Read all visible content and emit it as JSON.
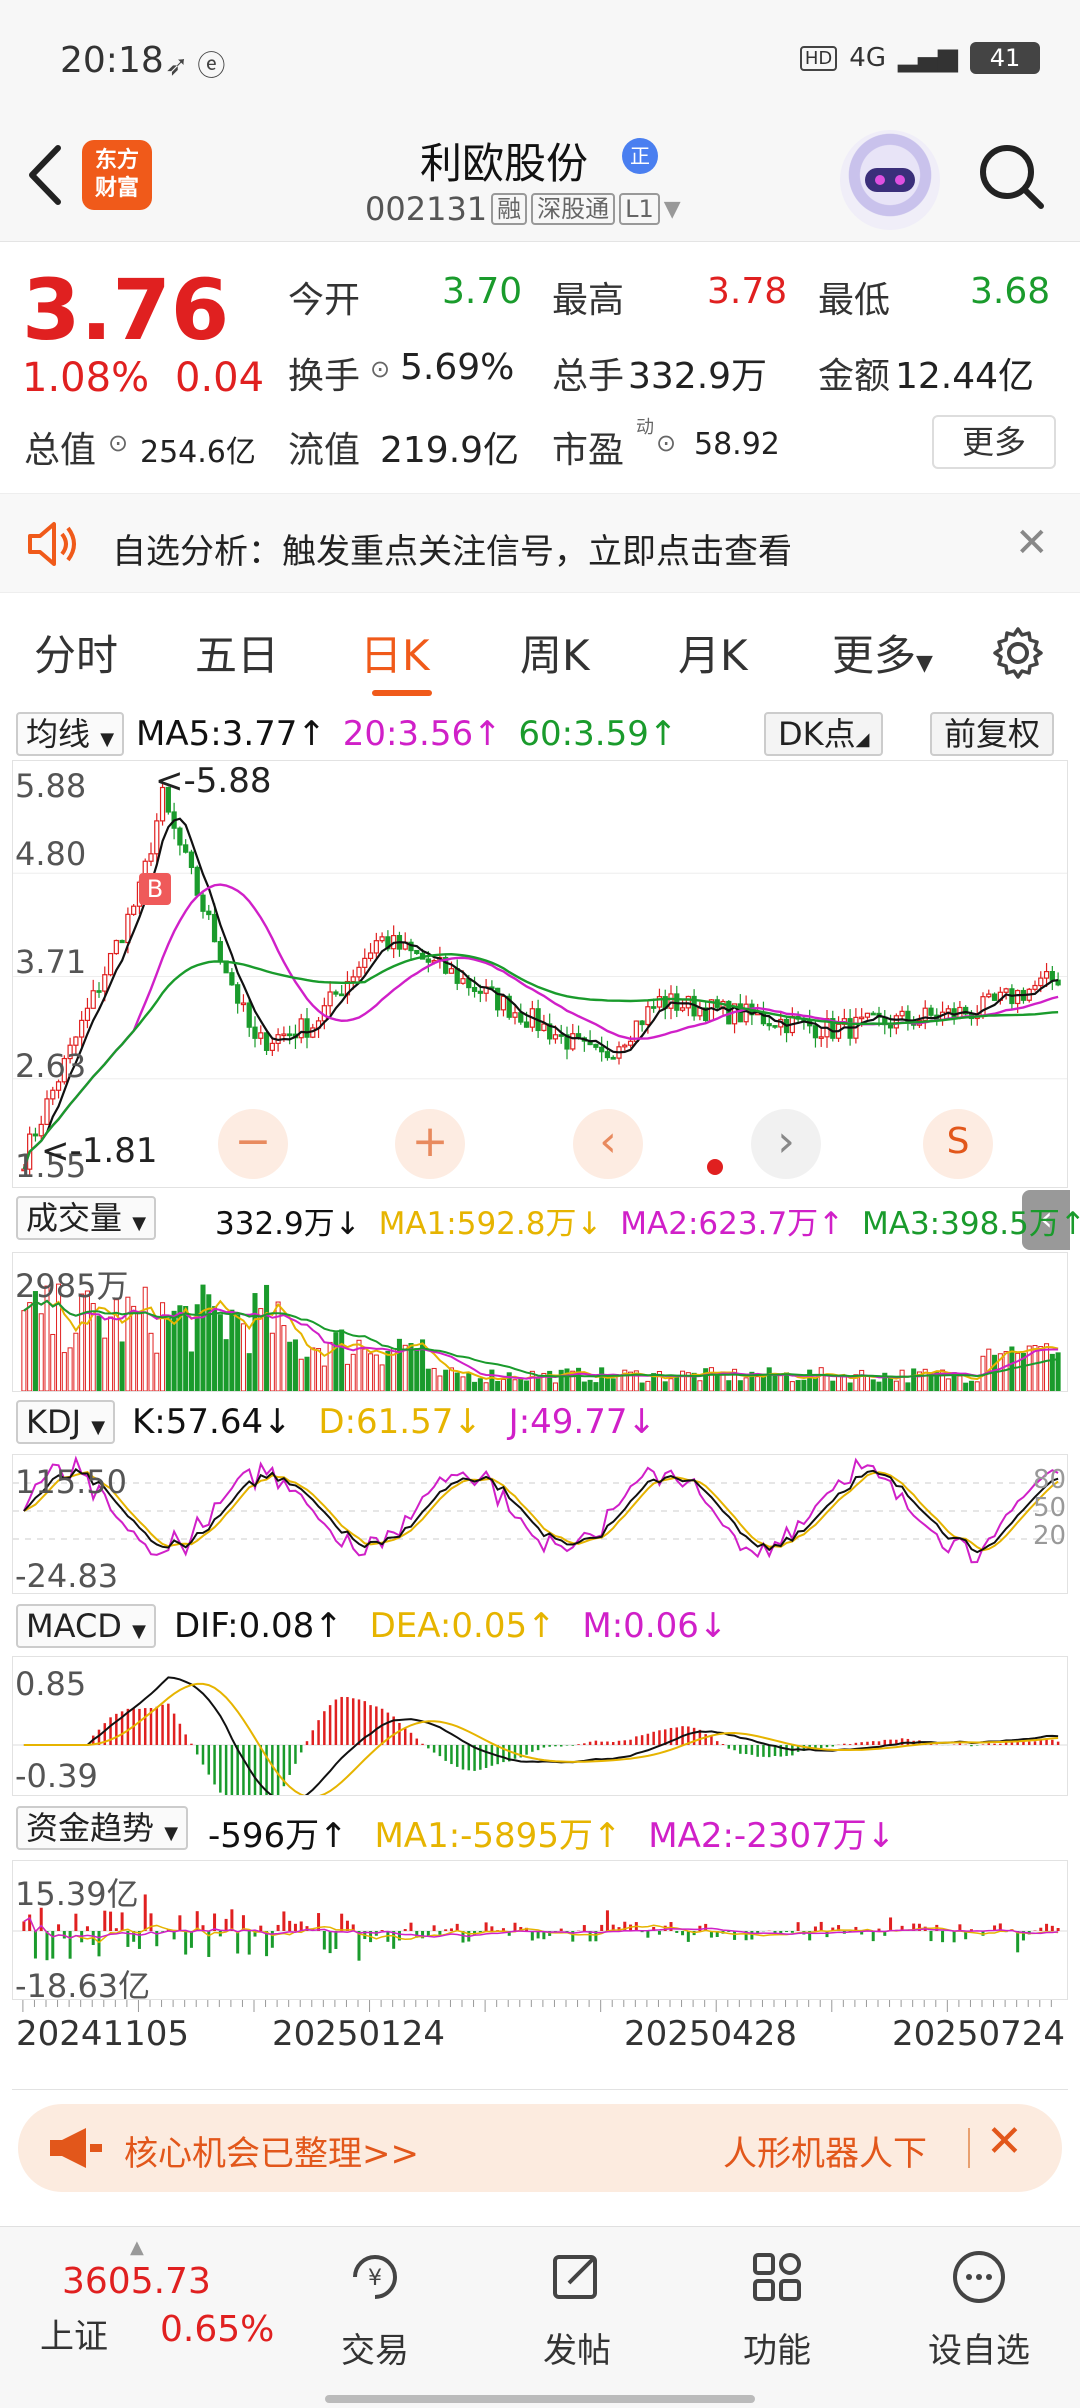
{
  "status": {
    "time": "20:18",
    "network": "4G",
    "battery": "41"
  },
  "header": {
    "logo_line1": "东方",
    "logo_line2": "财富",
    "stock_name": "利欧股份",
    "badge": "正",
    "stock_code": "002131",
    "tags": [
      "融",
      "深股通",
      "L1"
    ]
  },
  "quote": {
    "price": "3.76",
    "change_pct": "1.08%",
    "change": "0.04",
    "open_label": "今开",
    "open": "3.70",
    "high_label": "最高",
    "high": "3.78",
    "low_label": "最低",
    "low": "3.68",
    "turnover_label": "换手",
    "turnover": "5.69%",
    "volume_label": "总手",
    "volume": "332.9万",
    "amount_label": "金额",
    "amount": "12.44亿",
    "mcap_label": "总值",
    "mcap": "254.6亿",
    "float_label": "流值",
    "float_cap": "219.9亿",
    "pe_label": "市盈",
    "pe_sup": "动",
    "pe": "58.92",
    "more_label": "更多"
  },
  "alert": {
    "text": "自选分析：触发重点关注信号，立即点击查看"
  },
  "tabs": [
    "分时",
    "五日",
    "日K",
    "周K",
    "月K",
    "更多"
  ],
  "active_tab": "日K",
  "main_chart": {
    "indicator": "均线",
    "ma5": "MA5:3.77↑",
    "ma20": "20:3.56↑",
    "ma60": "60:3.59↑",
    "dk_label": "DK点",
    "adjust_label": "前复权",
    "y_labels": [
      "5.88",
      "4.80",
      "3.71",
      "2.63",
      "1.55"
    ],
    "high_marker": "<-5.88",
    "low_marker": "<-1.81",
    "buy_marker": "B"
  },
  "volume_panel": {
    "indicator": "成交量",
    "value": "332.9万↓",
    "ma1": "MA1:592.8万↓",
    "ma2": "MA2:623.7万↑",
    "ma3": "MA3:398.5万↑",
    "y_label": "2985万"
  },
  "kdj_panel": {
    "indicator": "KDJ",
    "k": "K:57.64↓",
    "d": "D:61.57↓",
    "j": "J:49.77↓",
    "y_top": "115.50",
    "y_bottom": "-24.83",
    "ref_80": "80",
    "ref_50": "50",
    "ref_20": "20"
  },
  "macd_panel": {
    "indicator": "MACD",
    "dif": "DIF:0.08↑",
    "dea": "DEA:0.05↑",
    "m": "M:0.06↓",
    "y_top": "0.85",
    "y_bottom": "-0.39"
  },
  "fund_panel": {
    "indicator": "资金趋势",
    "value": "-596万↑",
    "ma1": "MA1:-5895万↑",
    "ma2": "MA2:-2307万↓",
    "y_top": "15.39亿",
    "y_bottom": "-18.63亿"
  },
  "dates": [
    "20241105",
    "20250124",
    "20250428",
    "20250724"
  ],
  "promo": {
    "left": "核心机会已整理>>",
    "right": "人形机器人下"
  },
  "bottom_nav": {
    "index_value": "3605.73",
    "index_name": "上证",
    "index_pct": "0.65%",
    "items": [
      "交易",
      "发帖",
      "功能",
      "设自选"
    ]
  },
  "colors": {
    "up": "#e02020",
    "down": "#1a9b2c",
    "accent": "#f05a1a",
    "ma5": "#111111",
    "ma20": "#d020c8",
    "ma60": "#1a9b2c"
  }
}
